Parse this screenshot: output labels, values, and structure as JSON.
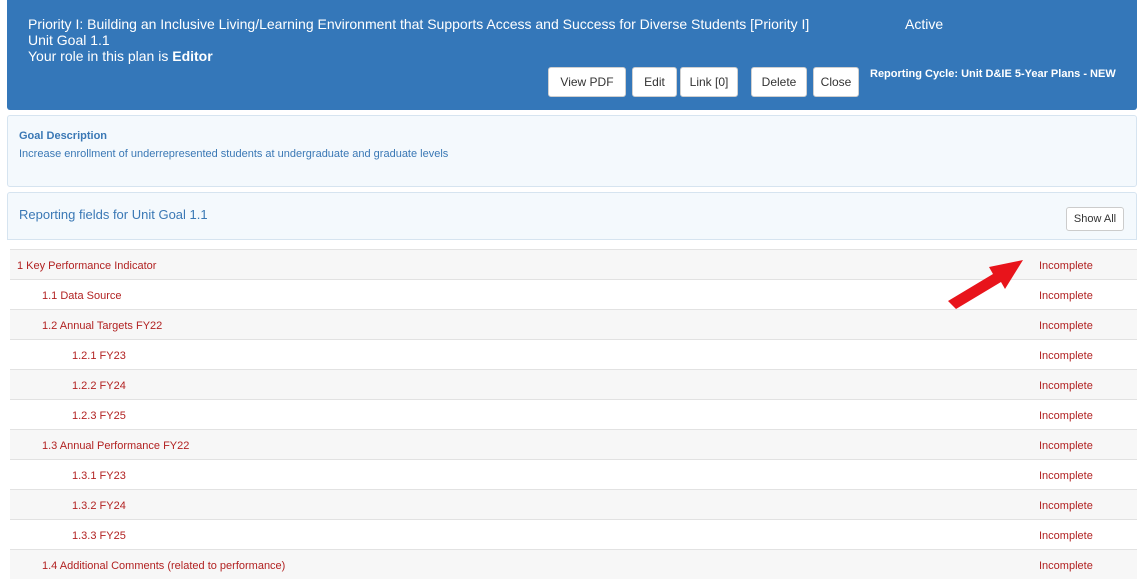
{
  "header": {
    "title": "Priority I: Building an Inclusive Living/Learning Environment that Supports Access and Success for Diverse Students [Priority I]",
    "status": "Active",
    "goal": "Unit Goal 1.1",
    "role_prefix": "Your role in this plan is ",
    "role": "Editor",
    "buttons": {
      "view_pdf": "View PDF",
      "edit": "Edit",
      "link": "Link [0]",
      "delete": "Delete",
      "close": "Close"
    },
    "cycle_label": "Reporting Cycle:",
    "cycle_value": " Unit D&IE 5-Year Plans - NEW"
  },
  "goal_panel": {
    "label": "Goal Description",
    "description": "Increase enrollment of underrepresented students at undergraduate and graduate levels"
  },
  "fields_panel": {
    "label": "Reporting fields for Unit Goal 1.1",
    "show_all": "Show All"
  },
  "rows": [
    {
      "name": "1 Key Performance Indicator",
      "status": "Incomplete"
    },
    {
      "name": "1.1 Data Source",
      "status": "Incomplete"
    },
    {
      "name": "1.2 Annual Targets FY22",
      "status": "Incomplete"
    },
    {
      "name": "1.2.1 FY23",
      "status": "Incomplete"
    },
    {
      "name": "1.2.2 FY24",
      "status": "Incomplete"
    },
    {
      "name": "1.2.3 FY25",
      "status": "Incomplete"
    },
    {
      "name": "1.3 Annual Performance FY22",
      "status": "Incomplete"
    },
    {
      "name": "1.3.1 FY23",
      "status": "Incomplete"
    },
    {
      "name": "1.3.2 FY24",
      "status": "Incomplete"
    },
    {
      "name": "1.3.3 FY25",
      "status": "Incomplete"
    },
    {
      "name": "1.4 Additional Comments (related to performance)",
      "status": "Incomplete"
    }
  ],
  "colors": {
    "header_bg": "#3477b9",
    "row_text": "#b22222",
    "annotation_arrow": "#e8141b"
  },
  "icons": {
    "annotation": "red-arrow-icon"
  }
}
